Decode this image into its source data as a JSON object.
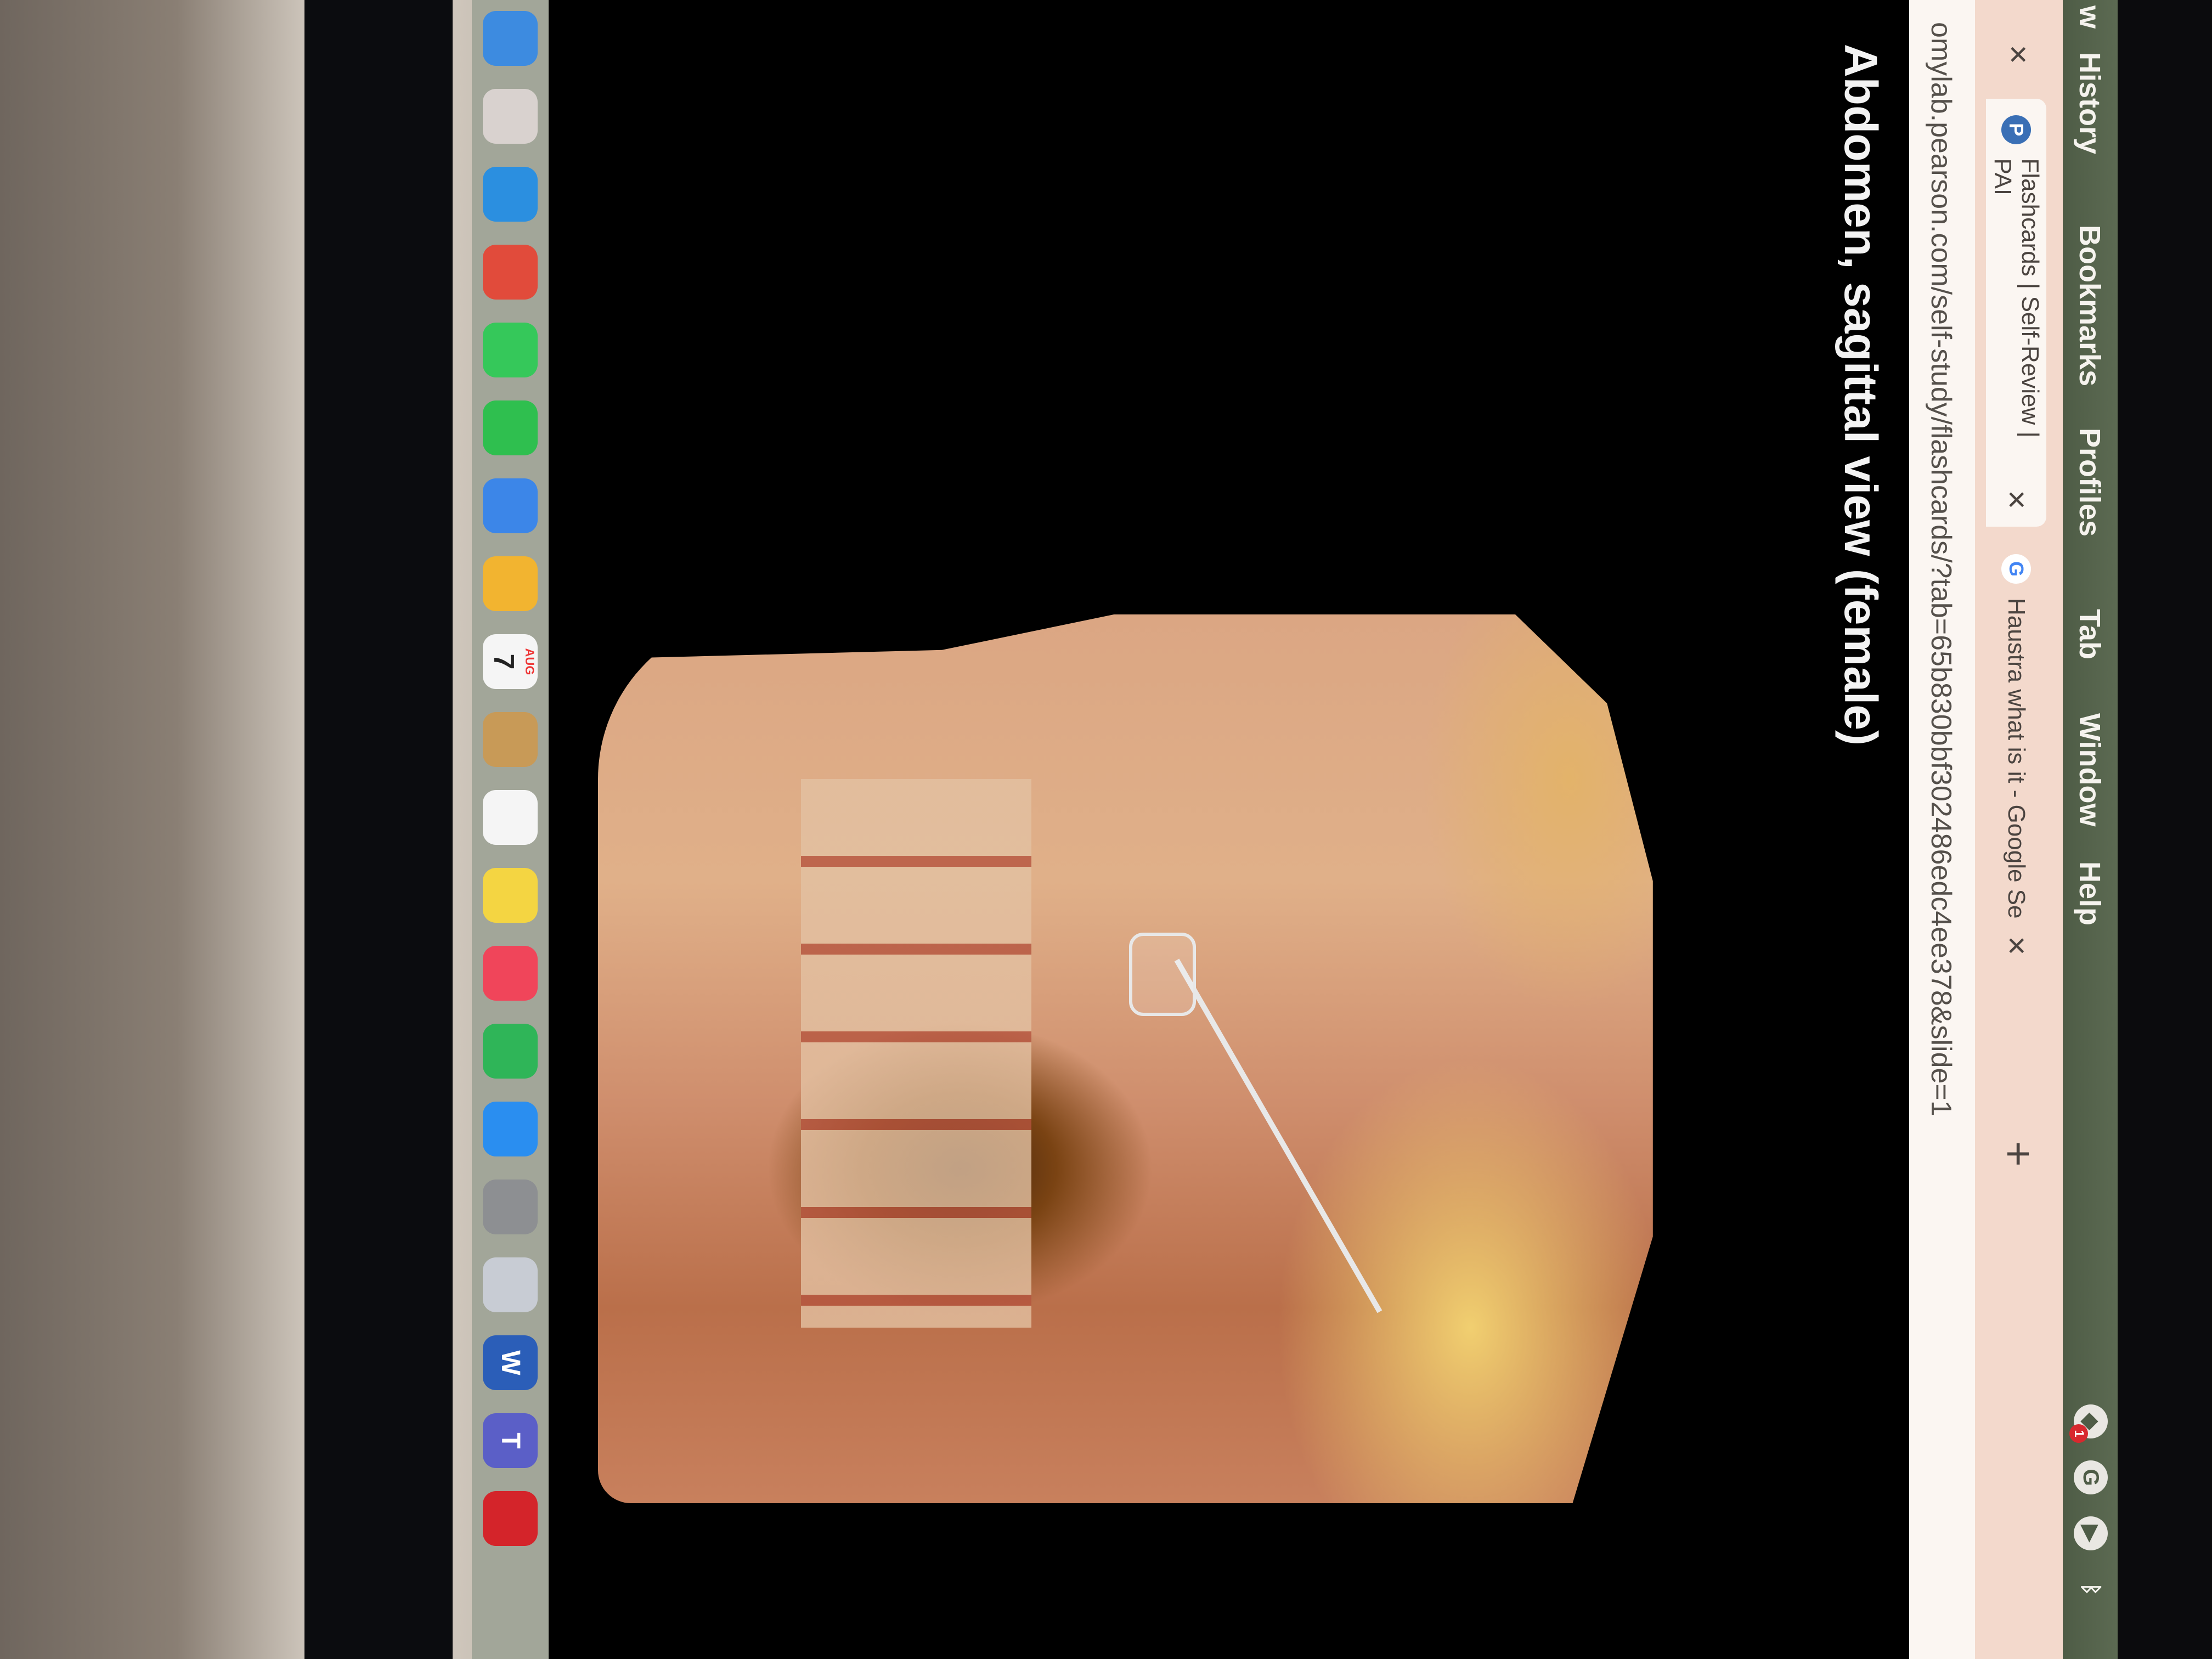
{
  "menubar": {
    "items": [
      "w",
      "History",
      "Bookmarks",
      "Profiles",
      "Tab",
      "Window",
      "Help"
    ],
    "status_icons": [
      "dropbox-icon",
      "grammarly-icon",
      "play-icon",
      "bluetooth-icon"
    ],
    "grammarly_glyph": "G",
    "dropbox_badge": "1"
  },
  "tabs": [
    {
      "label": "Flashcards | Self-Review | PAI",
      "favicon": "P",
      "active": true
    },
    {
      "label": "Haustra what is it - Google Se",
      "favicon": "G",
      "active": false
    }
  ],
  "addressbar": {
    "url": "omylab.pearson.com/self-study/flashcards/?tab=65b830bbf302486edc4ee378&slide=1"
  },
  "slide": {
    "title": "Abdomen, sagittal view (female)"
  },
  "dock": {
    "apps": [
      {
        "name": "finder-icon",
        "color": "#3d8be0",
        "glyph": ""
      },
      {
        "name": "launchpad-icon",
        "color": "#d9d2cf",
        "glyph": ""
      },
      {
        "name": "safari-icon",
        "color": "#2b8fe0",
        "glyph": ""
      },
      {
        "name": "chrome-icon",
        "color": "#e14b3b",
        "glyph": ""
      },
      {
        "name": "messages-icon",
        "color": "#35c85a",
        "glyph": ""
      },
      {
        "name": "facetime-icon",
        "color": "#2fbf4f",
        "glyph": ""
      },
      {
        "name": "mail-icon",
        "color": "#3c86e8",
        "glyph": ""
      },
      {
        "name": "photos-icon",
        "color": "#f2b430",
        "glyph": ""
      },
      {
        "name": "calendar-icon",
        "color": "#f5f5f5",
        "glyph": "7"
      },
      {
        "name": "contacts-icon",
        "color": "#c89a57",
        "glyph": ""
      },
      {
        "name": "reminders-icon",
        "color": "#f5f5f5",
        "glyph": ""
      },
      {
        "name": "notes-icon",
        "color": "#f4d542",
        "glyph": ""
      },
      {
        "name": "music-icon",
        "color": "#f0455a",
        "glyph": ""
      },
      {
        "name": "numbers-icon",
        "color": "#2fb558",
        "glyph": ""
      },
      {
        "name": "app-store-icon",
        "color": "#2a8ef0",
        "glyph": ""
      },
      {
        "name": "system-settings-icon",
        "color": "#8d8f92",
        "glyph": ""
      },
      {
        "name": "iphone-mirroring-icon",
        "color": "#c8ccd4",
        "glyph": ""
      },
      {
        "name": "word-icon",
        "color": "#2b5eb8",
        "glyph": "W"
      },
      {
        "name": "teams-icon",
        "color": "#5b5fc7",
        "glyph": "T"
      },
      {
        "name": "acrobat-icon",
        "color": "#d4242a",
        "glyph": ""
      }
    ],
    "calendar_month": "AUG"
  }
}
